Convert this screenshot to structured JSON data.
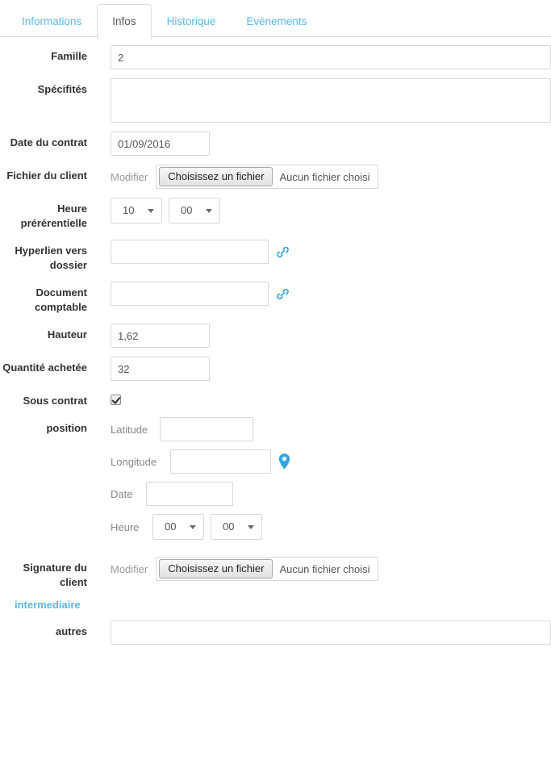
{
  "tabs": [
    {
      "label": "Informations",
      "active": false
    },
    {
      "label": "Infos",
      "active": true
    },
    {
      "label": "Historique",
      "active": false
    },
    {
      "label": "Evènements",
      "active": false
    }
  ],
  "colors": {
    "link": "#5bb9eb",
    "label": "#333333",
    "sublabel": "#888888",
    "border": "#d8d8d8",
    "icon": "#33a5e0"
  },
  "form": {
    "famille": {
      "label": "Famille",
      "value": "2"
    },
    "specifites": {
      "label": "Spécifités",
      "value": ""
    },
    "date_contrat": {
      "label": "Date du contrat",
      "value": "01/09/2016"
    },
    "fichier_client": {
      "label": "Fichier du client",
      "modify_label": "Modifier",
      "button_label": "Choisissez un fichier",
      "file_status": "Aucun fichier choisi"
    },
    "heure_preferentielle": {
      "label": "Heure prérérentielle",
      "hours": "10",
      "minutes": "00"
    },
    "hyperlien": {
      "label": "Hyperlien vers dossier",
      "value": "",
      "icon": "link-chain-icon"
    },
    "document_comptable": {
      "label": "Document comptable",
      "value": "",
      "icon": "link-chain-icon"
    },
    "hauteur": {
      "label": "Hauteur",
      "value": "1,62"
    },
    "quantite_achetee": {
      "label": "Quantité achetée",
      "value": "32"
    },
    "sous_contrat": {
      "label": "Sous contrat",
      "checked": true
    },
    "position": {
      "label": "position",
      "latitude_label": "Latitude",
      "latitude_value": "",
      "longitude_label": "Longitude",
      "longitude_value": "",
      "map_icon": "map-pin-icon",
      "date_label": "Date",
      "date_value": "",
      "heure_label": "Heure",
      "heure_hours": "00",
      "heure_minutes": "00"
    },
    "signature_client": {
      "label": "Signature du client",
      "modify_label": "Modifier",
      "button_label": "Choisissez un fichier",
      "file_status": "Aucun fichier choisi"
    },
    "intermediaire_link": "intermediaire",
    "autres": {
      "label": "autres",
      "value": ""
    }
  }
}
